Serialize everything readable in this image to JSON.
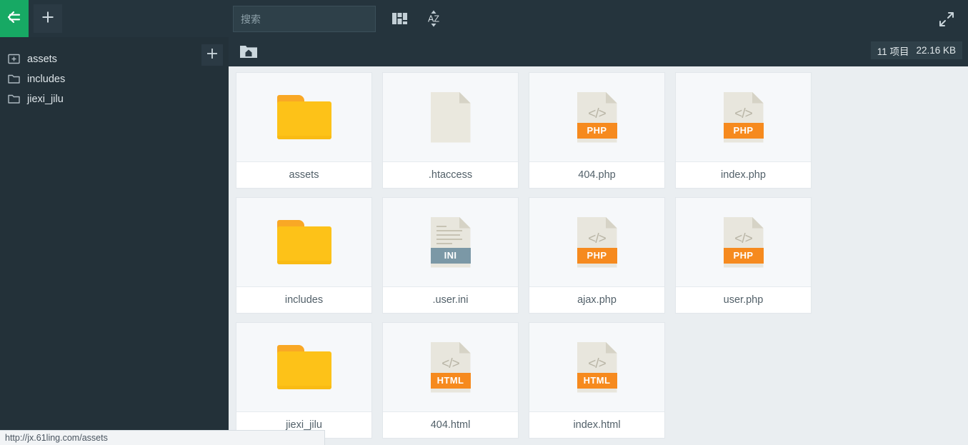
{
  "colors": {
    "topbar_bg": "#25343d",
    "sidebar_bg": "#233139",
    "accent_green": "#17a964",
    "content_bg": "#eaeef1",
    "php_badge": "#f68a1e",
    "ini_badge": "#7b98a6",
    "folder_yellow": "#fdc218"
  },
  "topbar": {
    "back_icon": "back-arrow-icon",
    "add_icon": "plus-icon",
    "columns_icon": "columns-view-icon",
    "sort_icon": "sort-az-icon",
    "expand_icon": "fullscreen-expand-icon",
    "sort_label": "AZ"
  },
  "search": {
    "value": "",
    "placeholder": "搜索"
  },
  "sidebar": {
    "add_icon": "plus-icon",
    "items": [
      {
        "label": "assets",
        "icon": "folder-expand-icon"
      },
      {
        "label": "includes",
        "icon": "folder-icon"
      },
      {
        "label": "jiexi_jilu",
        "icon": "folder-icon"
      }
    ]
  },
  "breadcrumb": {
    "home_icon": "home-folder-icon",
    "home_label": ""
  },
  "meta": {
    "count": "11 项目",
    "size": "22.16 KB"
  },
  "files": [
    {
      "name": "assets",
      "kind": "folder",
      "badge": ""
    },
    {
      "name": ".htaccess",
      "kind": "plain",
      "badge": ""
    },
    {
      "name": "404.php",
      "kind": "php",
      "badge": "PHP"
    },
    {
      "name": "index.php",
      "kind": "php",
      "badge": "PHP"
    },
    {
      "name": "includes",
      "kind": "folder",
      "badge": ""
    },
    {
      "name": ".user.ini",
      "kind": "ini",
      "badge": "INI"
    },
    {
      "name": "ajax.php",
      "kind": "php",
      "badge": "PHP"
    },
    {
      "name": "user.php",
      "kind": "php",
      "badge": "PHP"
    },
    {
      "name": "jiexi_jilu",
      "kind": "folder",
      "badge": ""
    },
    {
      "name": "404.html",
      "kind": "html",
      "badge": "HTML"
    },
    {
      "name": "index.html",
      "kind": "html",
      "badge": "HTML"
    }
  ],
  "statusbar": {
    "url": "http://jx.61ling.com/assets"
  }
}
